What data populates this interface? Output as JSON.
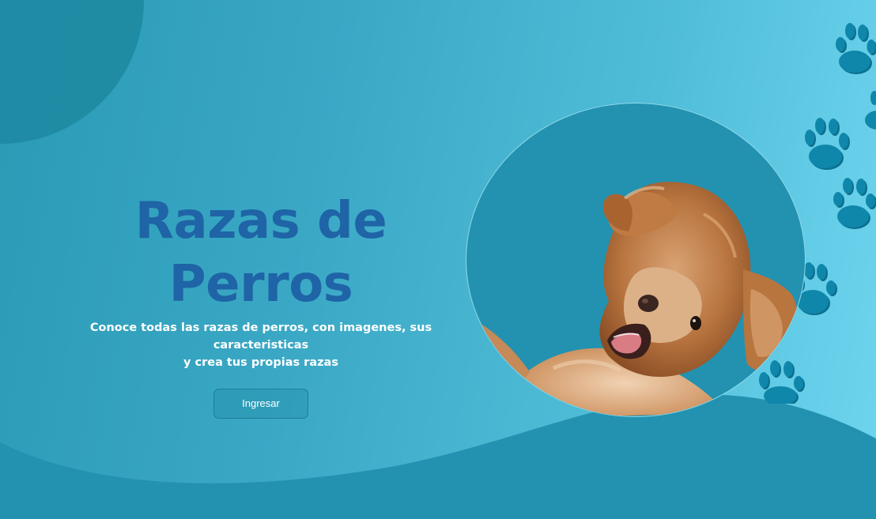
{
  "hero": {
    "title": "Razas de Perros",
    "subtitle_line1": "Conoce todas las razas de perros, con imagenes, sus caracteristicas",
    "subtitle_line2": "y crea tus propias razas",
    "button_label": "Ingresar"
  },
  "image": {
    "subject": "dog"
  },
  "colors": {
    "title": "#1f64a6",
    "background_start": "#2a9ab5",
    "background_end": "#6fd5ef",
    "wave": "#2292b0",
    "paw": "#0f87ab",
    "subtitle": "#ffffff"
  },
  "icons": [
    "paw-print-icon"
  ]
}
